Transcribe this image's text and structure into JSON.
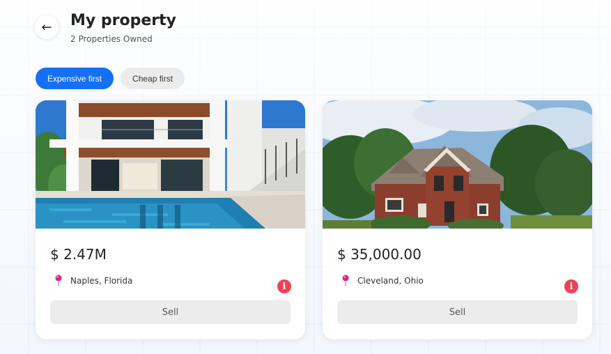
{
  "header": {
    "back_icon": "←",
    "title": "My property",
    "subtitle": "2 Properties Owned"
  },
  "sort": {
    "options": [
      {
        "label": "Expensive first",
        "active": true
      },
      {
        "label": "Cheap first",
        "active": false
      }
    ]
  },
  "properties": [
    {
      "price": "$ 2.47M",
      "location": "Naples, Florida",
      "sell_label": "Sell",
      "image": "modern-villa-with-pool"
    },
    {
      "price": "$ 35,000.00",
      "location": "Cleveland, Ohio",
      "sell_label": "Sell",
      "image": "brick-suburban-house"
    }
  ],
  "colors": {
    "accent": "#1670f7",
    "info": "#ef4257",
    "pin": "#e0208a"
  },
  "icons": {
    "back": "arrow-left-icon",
    "pin": "pin-icon",
    "info": "info-icon"
  }
}
